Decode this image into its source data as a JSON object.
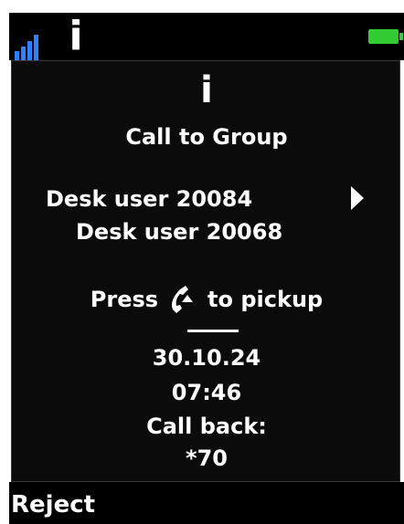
{
  "status_bar": {
    "signal_icon": "signal-icon",
    "info_icon_glyph": "i",
    "battery_icon": "battery-icon",
    "battery_color": "#33cc33",
    "signal_color": "#2f80ff"
  },
  "dialog": {
    "info_icon_glyph": "i",
    "title": "Call to Group",
    "callers": [
      "Desk user 20084",
      "Desk user 20068"
    ],
    "pickup_prefix": "Press",
    "pickup_suffix": "to pickup",
    "date": "30.10.24",
    "time": "07:46",
    "callback_label": "Call back:",
    "callback_code": "*70"
  },
  "softkeys": {
    "left": "Reject"
  }
}
